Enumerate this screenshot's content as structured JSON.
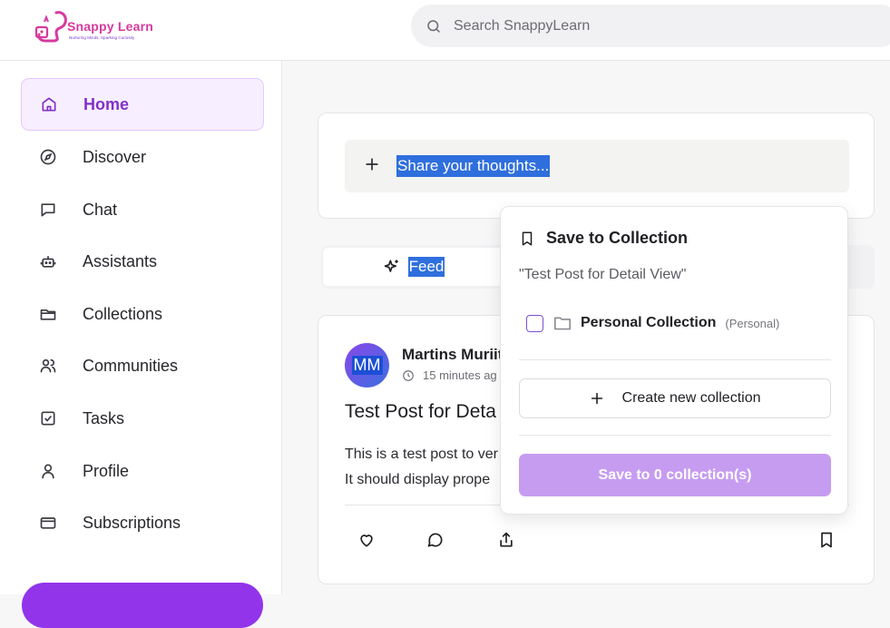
{
  "header": {
    "logo_text": "Snappy Learn",
    "logo_tagline": "Nurturing Minds, Sparking Curiosity",
    "search_placeholder": "Search SnappyLearn"
  },
  "sidebar": {
    "items": [
      {
        "label": "Home",
        "icon": "home-icon",
        "active": true
      },
      {
        "label": "Discover",
        "icon": "compass-icon"
      },
      {
        "label": "Chat",
        "icon": "chat-icon"
      },
      {
        "label": "Assistants",
        "icon": "bot-icon"
      },
      {
        "label": "Collections",
        "icon": "folder-icon"
      },
      {
        "label": "Communities",
        "icon": "users-icon"
      },
      {
        "label": "Tasks",
        "icon": "checkbox-icon"
      },
      {
        "label": "Profile",
        "icon": "user-icon"
      },
      {
        "label": "Subscriptions",
        "icon": "card-icon"
      }
    ]
  },
  "composer": {
    "placeholder": "Share your thoughts..."
  },
  "tabs": {
    "feed_label": "Feed"
  },
  "post": {
    "avatar_initials": "MM",
    "author": "Martins Muriit",
    "time": "15 minutes ag",
    "title": "Test Post for Deta",
    "body_line1": "This is a test post to ver",
    "body_line2": "It should display prope"
  },
  "popover": {
    "title": "Save to Collection",
    "post_title": "\"Test Post for Detail View\"",
    "collections": [
      {
        "name": "Personal Collection",
        "type": "(Personal)",
        "checked": false
      }
    ],
    "create_label": "Create new collection",
    "save_label": "Save to 0 collection(s)"
  },
  "colors": {
    "accent": "#9234ea",
    "active_nav_bg": "#f7efff",
    "save_button_disabled": "#c69cf1",
    "selection_highlight": "#2f6fdd"
  }
}
